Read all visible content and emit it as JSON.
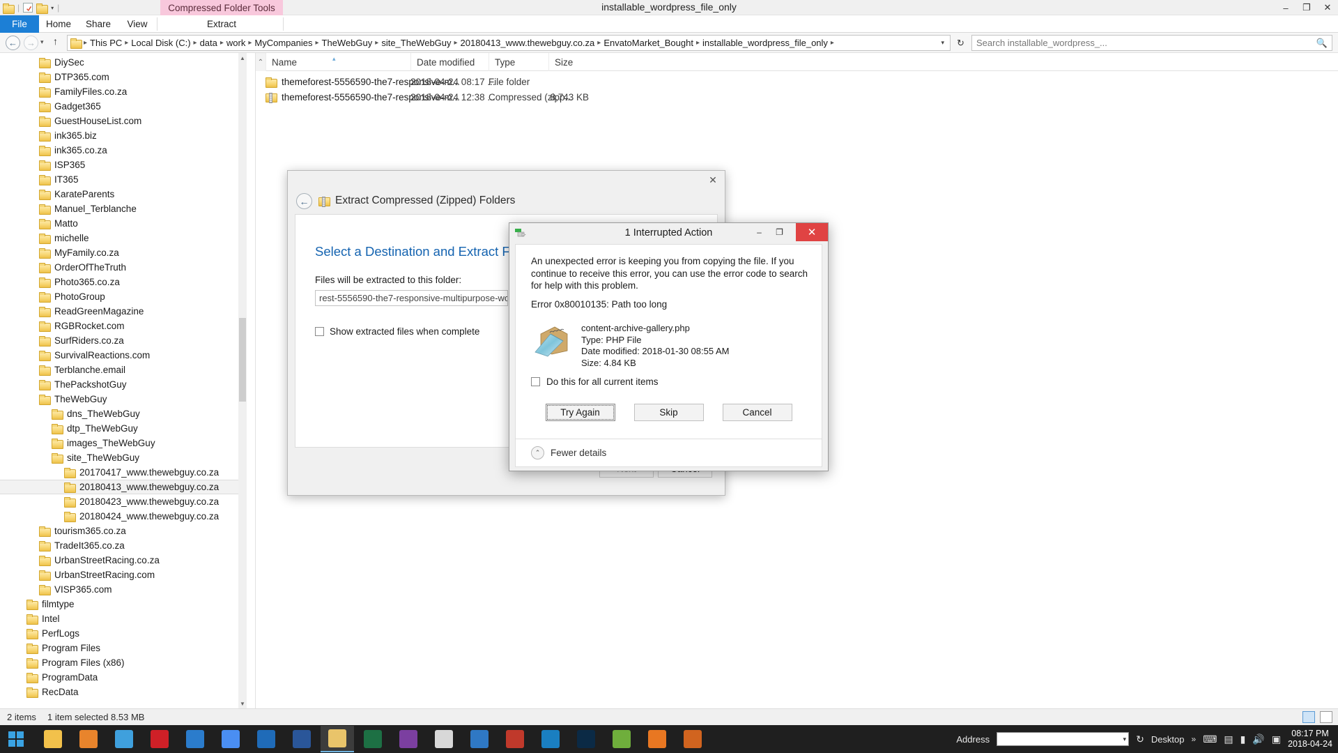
{
  "window": {
    "title": "installable_wordpress_file_only",
    "contextual_tab_group": "Compressed Folder Tools",
    "minimize": "–",
    "maximize": "❐",
    "close": "✕"
  },
  "quick_access_toolbar": {
    "folder_icon": "folder-icon",
    "properties_icon": "properties-icon",
    "new_folder_icon": "new-folder-icon",
    "dropdown_caret": "▾"
  },
  "ribbon": {
    "tabs": [
      {
        "label": "File",
        "id": "file"
      },
      {
        "label": "Home",
        "id": "home"
      },
      {
        "label": "Share",
        "id": "share"
      },
      {
        "label": "View",
        "id": "view"
      },
      {
        "label": "Extract",
        "id": "extract"
      }
    ]
  },
  "navigation": {
    "back": "←",
    "forward": "→",
    "recent_dropdown": "▾",
    "up": "↑",
    "refresh": "↻",
    "breadcrumbs": [
      "This PC",
      "Local Disk (C:)",
      "data",
      "work",
      "MyCompanies",
      "TheWebGuy",
      "site_TheWebGuy",
      "20180413_www.thewebguy.co.za",
      "EnvatoMarket_Bought",
      "installable_wordpress_file_only"
    ],
    "separator": "▸",
    "address_caret": "▾"
  },
  "search": {
    "placeholder": "Search installable_wordpress_...",
    "icon": "search-icon"
  },
  "tree": [
    {
      "label": "DiySec",
      "indent": 1
    },
    {
      "label": "DTP365.com",
      "indent": 1
    },
    {
      "label": "FamilyFiles.co.za",
      "indent": 1
    },
    {
      "label": "Gadget365",
      "indent": 1
    },
    {
      "label": "GuestHouseList.com",
      "indent": 1
    },
    {
      "label": "ink365.biz",
      "indent": 1
    },
    {
      "label": "ink365.co.za",
      "indent": 1
    },
    {
      "label": "ISP365",
      "indent": 1
    },
    {
      "label": "IT365",
      "indent": 1
    },
    {
      "label": "KarateParents",
      "indent": 1
    },
    {
      "label": "Manuel_Terblanche",
      "indent": 1
    },
    {
      "label": "Matto",
      "indent": 1
    },
    {
      "label": "michelle",
      "indent": 1
    },
    {
      "label": "MyFamily.co.za",
      "indent": 1
    },
    {
      "label": "OrderOfTheTruth",
      "indent": 1
    },
    {
      "label": "Photo365.co.za",
      "indent": 1
    },
    {
      "label": "PhotoGroup",
      "indent": 1
    },
    {
      "label": "ReadGreenMagazine",
      "indent": 1
    },
    {
      "label": "RGBRocket.com",
      "indent": 1
    },
    {
      "label": "SurfRiders.co.za",
      "indent": 1
    },
    {
      "label": "SurvivalReactions.com",
      "indent": 1
    },
    {
      "label": "Terblanche.email",
      "indent": 1
    },
    {
      "label": "ThePackshotGuy",
      "indent": 1
    },
    {
      "label": "TheWebGuy",
      "indent": 1
    },
    {
      "label": "dns_TheWebGuy",
      "indent": 2
    },
    {
      "label": "dtp_TheWebGuy",
      "indent": 2
    },
    {
      "label": "images_TheWebGuy",
      "indent": 2
    },
    {
      "label": "site_TheWebGuy",
      "indent": 2
    },
    {
      "label": "20170417_www.thewebguy.co.za",
      "indent": 3
    },
    {
      "label": "20180413_www.thewebguy.co.za",
      "indent": 3,
      "selected": true
    },
    {
      "label": "20180423_www.thewebguy.co.za",
      "indent": 3
    },
    {
      "label": "20180424_www.thewebguy.co.za",
      "indent": 3
    },
    {
      "label": "tourism365.co.za",
      "indent": 1
    },
    {
      "label": "TradeIt365.co.za",
      "indent": 1
    },
    {
      "label": "UrbanStreetRacing.co.za",
      "indent": 1
    },
    {
      "label": "UrbanStreetRacing.com",
      "indent": 1
    },
    {
      "label": "VISP365.com",
      "indent": 1
    },
    {
      "label": "filmtype",
      "indent": 0
    },
    {
      "label": "Intel",
      "indent": 0
    },
    {
      "label": "PerfLogs",
      "indent": 0
    },
    {
      "label": "Program Files",
      "indent": 0
    },
    {
      "label": "Program Files (x86)",
      "indent": 0
    },
    {
      "label": "ProgramData",
      "indent": 0
    },
    {
      "label": "RecData",
      "indent": 0
    }
  ],
  "filelist": {
    "columns": [
      {
        "label": "Name",
        "sorted": true,
        "sort_glyph": "▴"
      },
      {
        "label": "Date modified"
      },
      {
        "label": "Type"
      },
      {
        "label": "Size"
      }
    ],
    "rows": [
      {
        "name": "themeforest-5556590-the7-responsive-m...",
        "date": "2018-04-24 08:17 ...",
        "type": "File folder",
        "size": "",
        "icon": "folder-icon"
      },
      {
        "name": "themeforest-5556590-the7-responsive-m...",
        "date": "2018-04-24 12:38 ...",
        "type": "Compressed (zipp...",
        "size": "8,743 KB",
        "icon": "zip-icon"
      }
    ]
  },
  "extract_wizard": {
    "title": "Extract Compressed (Zipped) Folders",
    "back_glyph": "←",
    "close_glyph": "✕",
    "heading": "Select a Destination and Extract Files",
    "field_label": "Files will be extracted to this folder:",
    "field_value": "rest-5556590-the7-responsive-multipurpose-wordp",
    "checkbox_label": "Show extracted files when complete",
    "checkbox_checked": false,
    "next_label": "Next",
    "cancel_label": "Cancel",
    "next_disabled": true
  },
  "error_dialog": {
    "title": "1 Interrupted Action",
    "titlebar_icon": "copy-file-icon",
    "minimize": "–",
    "maximize": "❐",
    "close": "✕",
    "message": "An unexpected error is keeping you from copying the file. If you continue to receive this error, you can use the error code to search for help with this problem.",
    "error_code": "Error 0x80010135: Path too long",
    "file": {
      "icon": "php-file-icon",
      "name": "content-archive-gallery.php",
      "type": "Type: PHP File",
      "date_modified": "Date modified: 2018-01-30 08:55 AM",
      "size": "Size: 4.84 KB"
    },
    "checkbox_label": "Do this for all current items",
    "checkbox_checked": false,
    "buttons": [
      {
        "label": "Try Again",
        "primary": true
      },
      {
        "label": "Skip",
        "primary": false
      },
      {
        "label": "Cancel",
        "primary": false
      }
    ],
    "details_toggle": "Fewer details",
    "details_toggle_glyph": "⌃"
  },
  "statusbar": {
    "item_count": "2 items",
    "selection": "1 item selected  8.53 MB",
    "view_details_icon": "details-view-icon",
    "view_tiles_icon": "tiles-view-icon"
  },
  "taskbar": {
    "start_icon": "windows-start-icon",
    "items": [
      {
        "name": "file-explorer-taskbar-icon",
        "color": "#f2c14b"
      },
      {
        "name": "firefox-taskbar-icon",
        "color": "#e8842c"
      },
      {
        "name": "internet-explorer-taskbar-icon",
        "color": "#3fa0dd"
      },
      {
        "name": "opera-taskbar-icon",
        "color": "#cf2027"
      },
      {
        "name": "edge-taskbar-icon",
        "color": "#2b7ccc"
      },
      {
        "name": "chrome-taskbar-icon",
        "color": "#4a8ef2"
      },
      {
        "name": "outlook-taskbar-icon",
        "color": "#1f6bb8"
      },
      {
        "name": "word-taskbar-icon",
        "color": "#2a5699"
      },
      {
        "name": "explorer-window-taskbar-icon",
        "color": "#e9c46a",
        "active": true
      },
      {
        "name": "excel-taskbar-icon",
        "color": "#1d7044"
      },
      {
        "name": "onenote-taskbar-icon",
        "color": "#7b3fa0"
      },
      {
        "name": "calculator-taskbar-icon",
        "color": "#d8d8d8"
      },
      {
        "name": "mail-taskbar-icon",
        "color": "#2f78c4"
      },
      {
        "name": "filezilla-taskbar-icon",
        "color": "#c0392b"
      },
      {
        "name": "teamviewer-taskbar-icon",
        "color": "#1a7fc1"
      },
      {
        "name": "photoshop-taskbar-icon",
        "color": "#0b2a45"
      },
      {
        "name": "notepadpp-taskbar-icon",
        "color": "#6fae3c"
      },
      {
        "name": "firefox-dev-taskbar-icon",
        "color": "#e87722"
      },
      {
        "name": "flame-taskbar-icon",
        "color": "#d1641f"
      }
    ],
    "address_label": "Address",
    "address_value": "",
    "address_caret": "▾",
    "refresh_glyph": "↻",
    "desktop_label": "Desktop",
    "overflow_glyph": "»",
    "tray": {
      "keyboard_icon": "keyboard-icon",
      "flag_icon": "language-flag-icon",
      "network_icon": "network-icon",
      "volume_icon": "volume-icon",
      "action_center_icon": "action-center-icon"
    },
    "clock_time": "08:17 PM",
    "clock_date": "2018-04-24"
  }
}
